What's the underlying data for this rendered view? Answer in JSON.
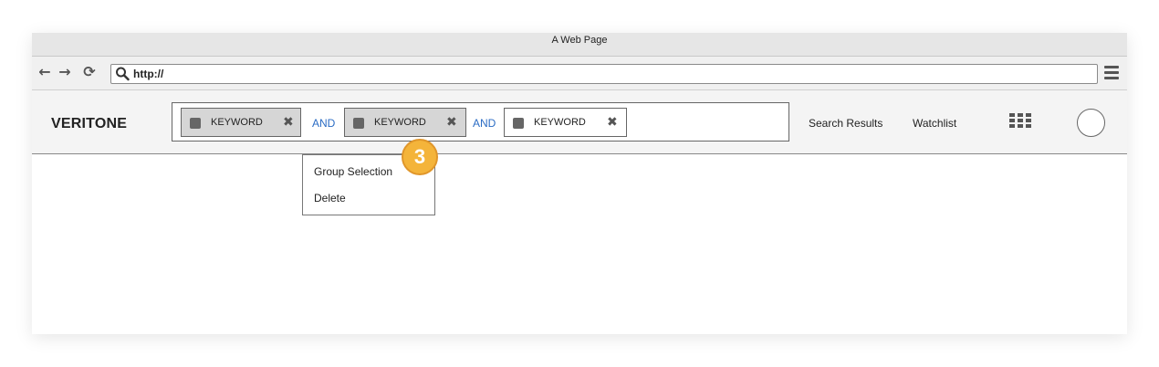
{
  "browser": {
    "title": "A Web Page",
    "url": "http://",
    "icons": [
      "arrow-left-icon",
      "arrow-right-icon",
      "refresh-icon",
      "search-icon",
      "hamburger-menu-icon"
    ]
  },
  "app": {
    "brand": "VERITONE",
    "search": {
      "chips": [
        {
          "label": "KEYWORD",
          "state": "selected"
        },
        {
          "label": "KEYWORD",
          "state": "selected"
        },
        {
          "label": "KEYWORD",
          "state": "normal"
        }
      ],
      "operators": [
        "AND",
        "AND"
      ]
    },
    "nav": {
      "search_results": "Search Results",
      "watchlist": "Watchlist"
    }
  },
  "context_menu": {
    "items": [
      "Group Selection",
      "Delete"
    ]
  },
  "annotation": {
    "badge": "3"
  },
  "colors": {
    "operator_blue": "#2b6cc4",
    "badge_orange": "#f4b43a",
    "chip_selected_bg": "#d6d6d6"
  }
}
